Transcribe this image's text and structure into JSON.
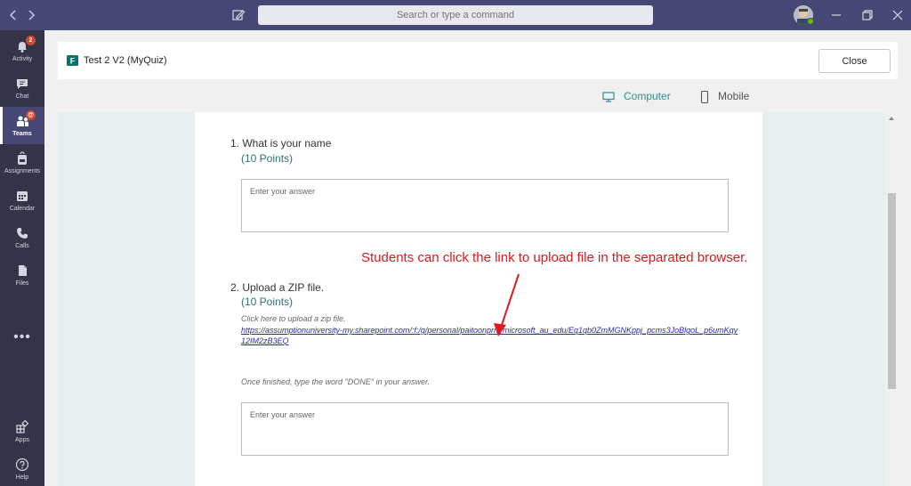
{
  "titlebar": {
    "search_placeholder": "Search or type a command",
    "back_icon": "chevron-left-icon",
    "forward_icon": "chevron-right-icon",
    "compose_icon": "compose-icon",
    "window_controls": [
      "minimize-icon",
      "restore-icon",
      "close-icon"
    ]
  },
  "rail": {
    "items": [
      {
        "label": "Activity",
        "icon": "bell-icon",
        "badge": "2"
      },
      {
        "label": "Chat",
        "icon": "chat-icon"
      },
      {
        "label": "Teams",
        "icon": "teams-icon",
        "badge": "@",
        "active": true
      },
      {
        "label": "Assignments",
        "icon": "backpack-icon"
      },
      {
        "label": "Calendar",
        "icon": "calendar-icon"
      },
      {
        "label": "Calls",
        "icon": "phone-icon"
      },
      {
        "label": "Files",
        "icon": "file-icon"
      }
    ],
    "more": "•••",
    "bottom": [
      {
        "label": "Apps",
        "icon": "apps-icon"
      },
      {
        "label": "Help",
        "icon": "help-icon"
      }
    ]
  },
  "dialog": {
    "title": "Test 2 V2 (MyQuiz)",
    "close_label": "Close"
  },
  "viewbar": {
    "computer_label": "Computer",
    "mobile_label": "Mobile",
    "computer_color": "#2f8f8f"
  },
  "form": {
    "questions": [
      {
        "title": "1. What is your name",
        "points": "(10 Points)",
        "placeholder": "Enter your answer"
      },
      {
        "title": "2. Upload a ZIP file.",
        "points": "(10 Points)",
        "desc": "Click here to upload a zip file.",
        "link": "https://assumptionuniversity-my.sharepoint.com/:f:/g/personal/paitoonprn_microsoft_au_edu/Eq1qb0ZmMGNKppj_pcms3JoBlgoL_p6umKqy12IM2zB3EQ",
        "note": "Once finished, type the word \"DONE\" in your answer.",
        "placeholder": "Enter your answer"
      }
    ]
  },
  "annotation": {
    "text": "Students can click the link to upload file in the separated browser.",
    "color": "#e0191b"
  }
}
